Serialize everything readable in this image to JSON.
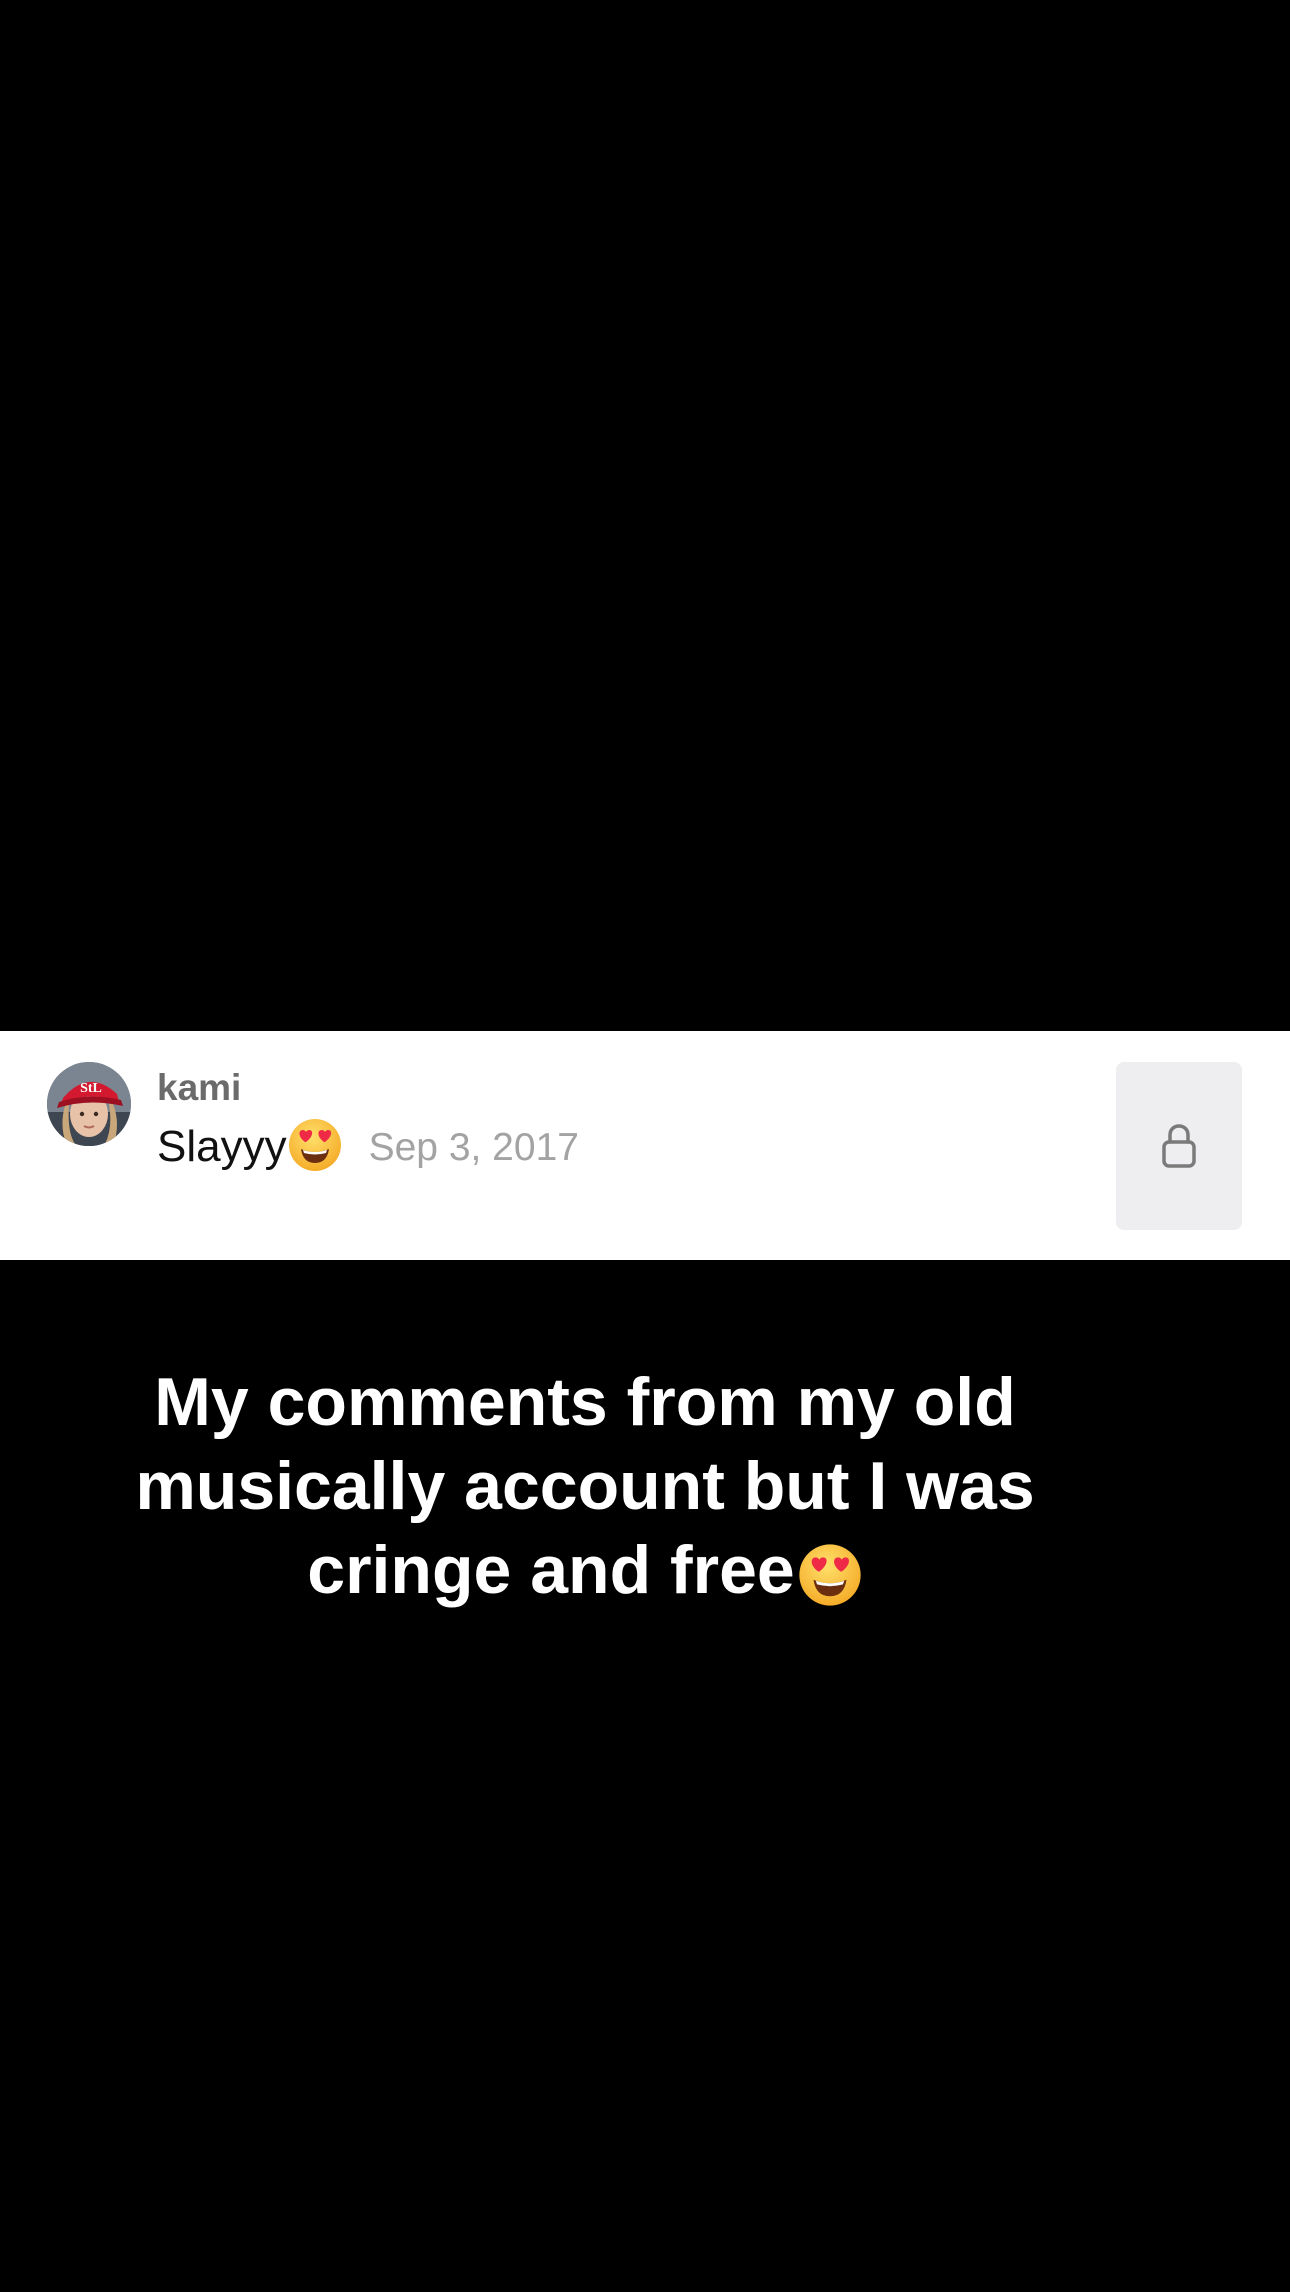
{
  "comment": {
    "username": "kami",
    "text": "Slayyy",
    "emoji_icon": "heart-eyes-emoji",
    "date": "Sep 3, 2017",
    "lock_icon": "lock-icon"
  },
  "caption": {
    "line1": "My comments from my old",
    "line2": "musically account but I was",
    "line3": "cringe and free",
    "emoji_icon": "heart-eyes-emoji"
  },
  "colors": {
    "background": "#000000",
    "card": "#ffffff",
    "username": "#6b6b6b",
    "comment_text": "#111111",
    "date": "#a3a3a3",
    "lock_button_bg": "#eeeef0",
    "caption": "#ffffff"
  }
}
